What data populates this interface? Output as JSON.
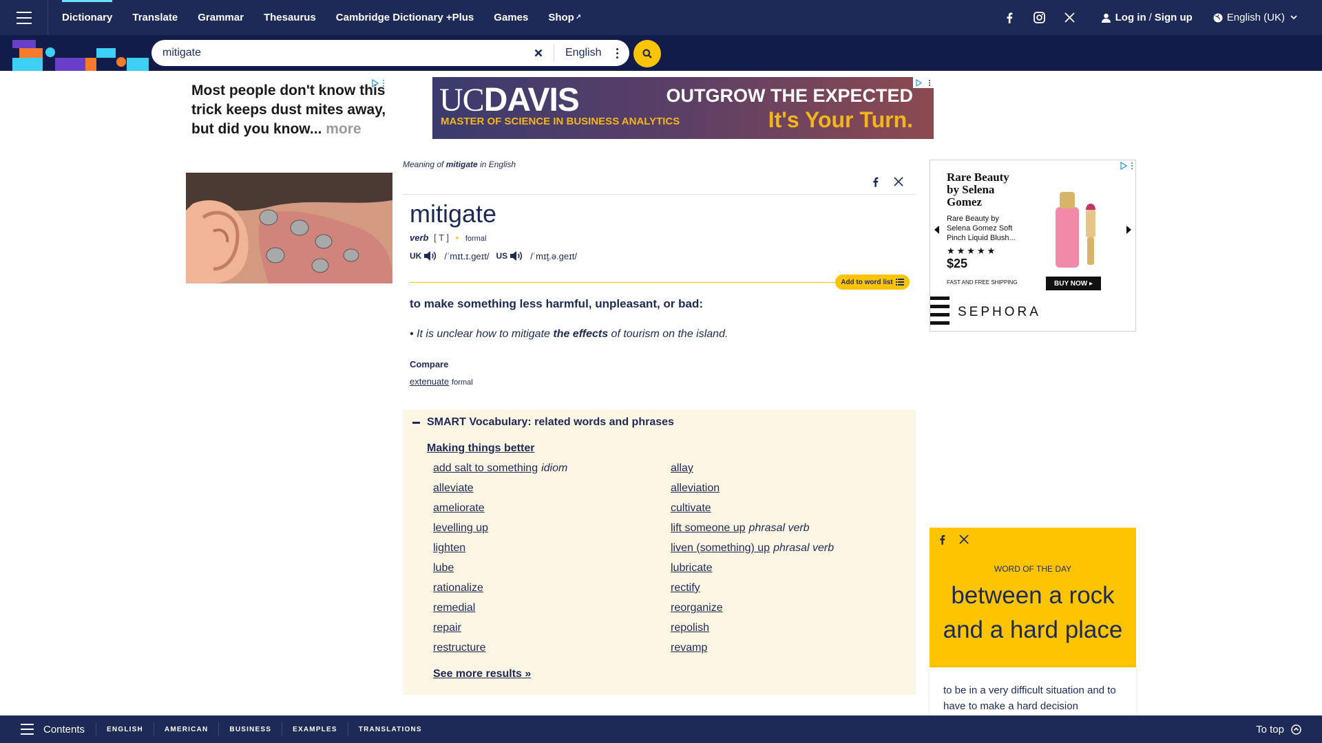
{
  "nav": {
    "items": [
      {
        "label": "Dictionary",
        "active": true
      },
      {
        "label": "Translate"
      },
      {
        "label": "Grammar"
      },
      {
        "label": "Thesaurus"
      },
      {
        "label": "Cambridge Dictionary +Plus"
      },
      {
        "label": "Games"
      },
      {
        "label": "Shop"
      }
    ],
    "login": "Log in",
    "login_sep": "/",
    "signup": "Sign up",
    "language": "English (UK)",
    "social_icons": [
      "facebook-icon",
      "instagram-icon",
      "x-icon"
    ]
  },
  "search": {
    "value": "mitigate",
    "dictionary": "English"
  },
  "ads": {
    "text_ad": {
      "line": "Most people don't know this trick keeps dust mites away, but did you know...",
      "more": "more"
    },
    "banner": {
      "uc": "UC",
      "davis": "DAVIS",
      "subtitle": "MASTER OF SCIENCE IN BUSINESS ANALYTICS",
      "headline": "OUTGROW THE EXPECTED",
      "tagline": "It's Your Turn."
    },
    "right": {
      "brand": "Rare Beauty by Selena Gomez",
      "desc": "Rare Beauty by Selena Gomez Soft Pinch Liquid Blush...",
      "stars": "★★★★★",
      "price": "$25",
      "shipping": "FAST AND FREE SHIPPING",
      "buy": "BUY NOW ▸",
      "store": "SEPHORA"
    }
  },
  "entry": {
    "meaning_prefix": "Meaning of",
    "word": "mitigate",
    "meaning_suffix": "in English",
    "headword": "mitigate",
    "pos": "verb",
    "grammar": "[ T ]",
    "usage": "formal",
    "uk_label": "UK",
    "uk_ipa": "/ˈmɪt.ɪ.ɡeɪt/",
    "us_label": "US",
    "us_ipa": "/ˈmɪt̬.ə.ɡeɪt/",
    "add_to_list": "Add to word list",
    "definition": "to make something less harmful, unpleasant, or bad:",
    "example_pre": "It is unclear how to mitigate ",
    "example_bold": "the effects",
    "example_post": " of tourism on the island.",
    "compare_heading": "Compare",
    "compare_word": "extenuate",
    "compare_label": "formal"
  },
  "smart": {
    "heading": "SMART Vocabulary: related words and phrases",
    "topic": "Making things better",
    "items": [
      {
        "word": "add salt to something",
        "label": "idiom"
      },
      {
        "word": "allay",
        "label": ""
      },
      {
        "word": "alleviate",
        "label": ""
      },
      {
        "word": "alleviation",
        "label": ""
      },
      {
        "word": "ameliorate",
        "label": ""
      },
      {
        "word": "cultivate",
        "label": ""
      },
      {
        "word": "levelling up",
        "label": ""
      },
      {
        "word": "lift someone up",
        "label": "phrasal verb"
      },
      {
        "word": "lighten",
        "label": ""
      },
      {
        "word": "liven (something) up",
        "label": "phrasal verb"
      },
      {
        "word": "lube",
        "label": ""
      },
      {
        "word": "lubricate",
        "label": ""
      },
      {
        "word": "rationalize",
        "label": ""
      },
      {
        "word": "rectify",
        "label": ""
      },
      {
        "word": "remedial",
        "label": ""
      },
      {
        "word": "reorganize",
        "label": ""
      },
      {
        "word": "repair",
        "label": ""
      },
      {
        "word": "repolish",
        "label": ""
      },
      {
        "word": "restructure",
        "label": ""
      },
      {
        "word": "revamp",
        "label": ""
      }
    ],
    "see_more": "See more results »"
  },
  "wotd": {
    "label": "WORD OF THE DAY",
    "word": "between a rock and a hard place",
    "definition": "to be in a very difficult situation and to have to make a hard decision"
  },
  "bottom": {
    "contents": "Contents",
    "tabs": [
      "ENGLISH",
      "AMERICAN",
      "BUSINESS",
      "EXAMPLES",
      "TRANSLATIONS"
    ],
    "to_top": "To top"
  },
  "colors": {
    "navy": "#1d2a57",
    "search_bar": "#111c4a",
    "accent_yellow": "#fec400",
    "smart_bg": "#fef6e4",
    "active_tab": "#6de0f7"
  }
}
